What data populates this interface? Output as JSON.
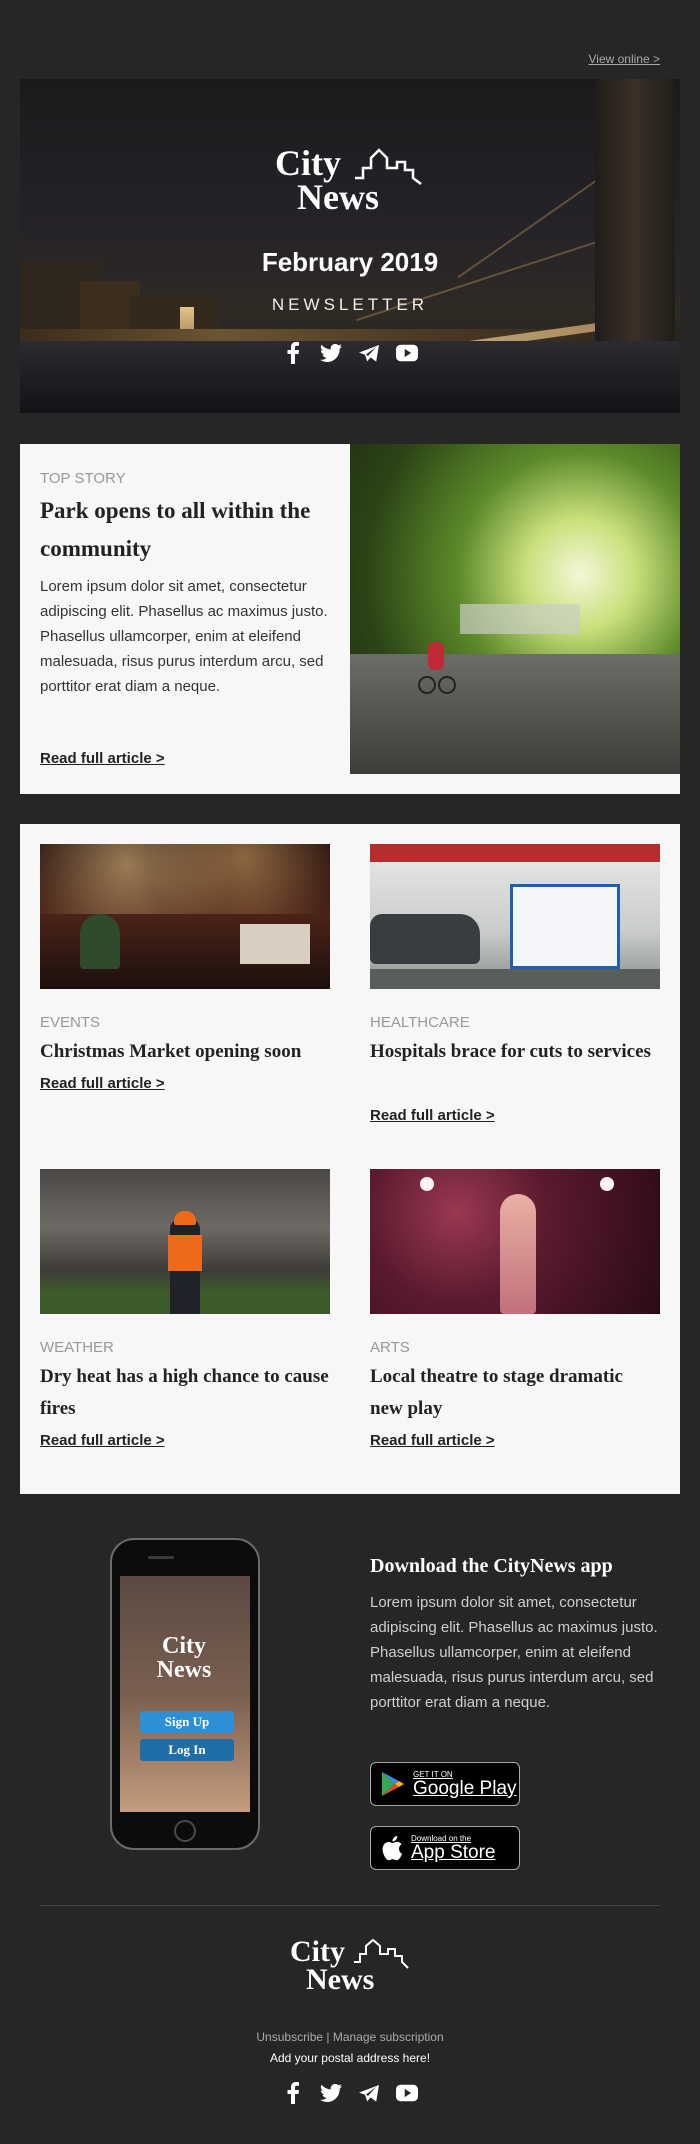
{
  "view_online": "View online >",
  "brand": {
    "line1": "City",
    "line2": "News"
  },
  "hero": {
    "title": "February 2019",
    "subtitle": "NEWSLETTER"
  },
  "social_icons": [
    "facebook-icon",
    "twitter-icon",
    "telegram-icon",
    "youtube-icon"
  ],
  "top_story": {
    "kicker": "TOP STORY",
    "headline": "Park opens to all within the community",
    "body": "Lorem ipsum dolor sit amet, consectetur adipiscing elit. Phasellus ac maximus justo. Phasellus ullamcorper, enim at eleifend malesuada, risus purus interdum arcu, sed porttitor erat diam a neque.",
    "link": "Read full article >"
  },
  "articles": [
    {
      "kicker": "EVENTS",
      "headline": "Christmas Market opening soon",
      "link": "Read full article >"
    },
    {
      "kicker": "HEALTHCARE",
      "headline": "Hospitals brace for cuts to services",
      "link": "Read full article >"
    },
    {
      "kicker": "WEATHER",
      "headline": "Dry heat has a high chance to cause fires",
      "link": "Read full article >"
    },
    {
      "kicker": "ARTS",
      "headline": "Local theatre to stage dramatic new play",
      "link": "Read full article >"
    }
  ],
  "app": {
    "title": "Download the CityNews app",
    "body": "Lorem ipsum dolor sit amet, consectetur adipiscing elit. Phasellus ac maximus justo. Phasellus ullamcorper, enim at eleifend malesuada, risus purus interdum arcu, sed porttitor erat diam a neque.",
    "phone_signup": "Sign Up",
    "phone_login": "Log In",
    "google_small": "GET IT ON",
    "google_big": "Google Play",
    "apple_small": "Download on the",
    "apple_big": "App Store"
  },
  "footer": {
    "unsubscribe": "Unsubscribe",
    "separator": "|",
    "manage": "Manage subscription",
    "address": "Add your postal address here!"
  },
  "colors": {
    "background": "#262626",
    "panel": "#f7f7f7",
    "phone_button": "#2d8fd5"
  }
}
